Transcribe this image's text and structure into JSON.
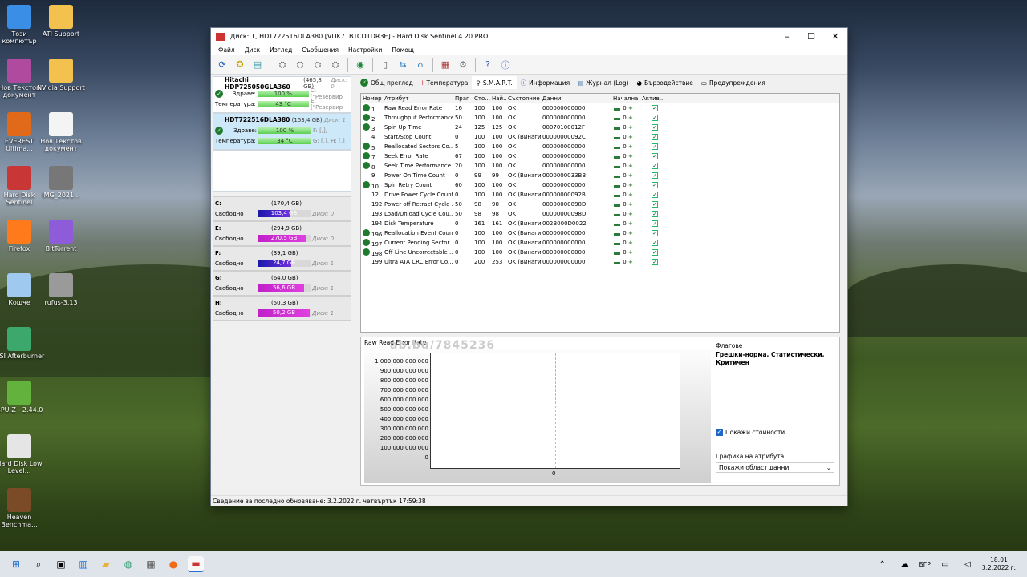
{
  "window": {
    "title": "Диск: 1, HDT722516DLA380 [VDK71BTCD1DR3E]  -  Hard Disk Sentinel 4.20 PRO"
  },
  "menu": [
    "Файл",
    "Диск",
    "Изглед",
    "Съобщения",
    "Настройки",
    "Помощ"
  ],
  "disks": [
    {
      "name": "Hitachi HDP725050GLA360",
      "size": "(465,8 GB)",
      "disk": "Диск: 0",
      "health_label": "Здраве:",
      "health": "100 %",
      "health_extra": "C: [\"Резервир",
      "temp_label": "Температура:",
      "temp": "43 °C",
      "temp_extra": "E: [\"Резервир"
    },
    {
      "name": "HDT722516DLA380",
      "size": "(153,4 GB)",
      "disk": "Диск: 1",
      "health_label": "Здраве:",
      "health": "100 %",
      "health_extra": "F: [,],",
      "temp_label": "Температура:",
      "temp": "34 °C",
      "temp_extra": "G: [,], H: [,]"
    }
  ],
  "partitions": [
    {
      "letter": "C:",
      "size": "(170,4 GB)",
      "free_label": "Свободно",
      "free": "103,4 GB",
      "disk": "Диск: 0",
      "fill": 0.61
    },
    {
      "letter": "E:",
      "size": "(294,9 GB)",
      "free_label": "Свободно",
      "free": "270,5 GB",
      "disk": "Диск: 0",
      "fill": 0.92
    },
    {
      "letter": "F:",
      "size": "(39,1 GB)",
      "free_label": "Свободно",
      "free": "24,7 GB",
      "disk": "Диск: 1",
      "fill": 0.63
    },
    {
      "letter": "G:",
      "size": "(64,0 GB)",
      "free_label": "Свободно",
      "free": "56,6 GB",
      "disk": "Диск: 1",
      "fill": 0.88
    },
    {
      "letter": "H:",
      "size": "(50,3 GB)",
      "free_label": "Свободно",
      "free": "50,2 GB",
      "disk": "Диск: 1",
      "fill": 0.99
    }
  ],
  "tabs": [
    "Общ преглед",
    "Температура",
    "S.M.A.R.T.",
    "Информация",
    "Журнал (Log)",
    "Бързодействие",
    "Предупреждения"
  ],
  "smart": {
    "headers": [
      "Номер",
      "Атрибут",
      "Праг",
      "Сто...",
      "Най...",
      "Състояние",
      "Данни",
      "Начална",
      "Актив..."
    ],
    "rows": [
      {
        "n": "1",
        "attr": "Raw Read Error Rate",
        "th": "16",
        "v": "100",
        "w": "100",
        "st": "OK",
        "data": "000000000000",
        "start": "0",
        "ok": true
      },
      {
        "n": "2",
        "attr": "Throughput Performance",
        "th": "50",
        "v": "100",
        "w": "100",
        "st": "OK",
        "data": "000000000000",
        "start": "0",
        "ok": true
      },
      {
        "n": "3",
        "attr": "Spin Up Time",
        "th": "24",
        "v": "125",
        "w": "125",
        "st": "OK",
        "data": "00070100012F",
        "start": "0",
        "ok": true
      },
      {
        "n": "4",
        "attr": "Start/Stop Count",
        "th": "0",
        "v": "100",
        "w": "100",
        "st": "OK (Винаги...",
        "data": "00000000092C",
        "start": "0",
        "ok": false
      },
      {
        "n": "5",
        "attr": "Reallocated Sectors Co...",
        "th": "5",
        "v": "100",
        "w": "100",
        "st": "OK",
        "data": "000000000000",
        "start": "0",
        "ok": true
      },
      {
        "n": "7",
        "attr": "Seek Error Rate",
        "th": "67",
        "v": "100",
        "w": "100",
        "st": "OK",
        "data": "000000000000",
        "start": "0",
        "ok": true
      },
      {
        "n": "8",
        "attr": "Seek Time Performance",
        "th": "20",
        "v": "100",
        "w": "100",
        "st": "OK",
        "data": "000000000000",
        "start": "0",
        "ok": true
      },
      {
        "n": "9",
        "attr": "Power On Time Count",
        "th": "0",
        "v": "99",
        "w": "99",
        "st": "OK (Винаги...",
        "data": "0000000033BB",
        "start": "0",
        "ok": false
      },
      {
        "n": "10",
        "attr": "Spin Retry Count",
        "th": "60",
        "v": "100",
        "w": "100",
        "st": "OK",
        "data": "000000000000",
        "start": "0",
        "ok": true
      },
      {
        "n": "12",
        "attr": "Drive Power Cycle Count",
        "th": "0",
        "v": "100",
        "w": "100",
        "st": "OK (Винаги...",
        "data": "00000000092B",
        "start": "0",
        "ok": false
      },
      {
        "n": "192",
        "attr": "Power off Retract Cycle ...",
        "th": "50",
        "v": "98",
        "w": "98",
        "st": "OK",
        "data": "00000000098D",
        "start": "0",
        "ok": false
      },
      {
        "n": "193",
        "attr": "Load/Unload Cycle Cou...",
        "th": "50",
        "v": "98",
        "w": "98",
        "st": "OK",
        "data": "00000000098D",
        "start": "0",
        "ok": false
      },
      {
        "n": "194",
        "attr": "Disk Temperature",
        "th": "0",
        "v": "161",
        "w": "161",
        "st": "OK (Винаги...",
        "data": "002B000D0022",
        "start": "0",
        "ok": false
      },
      {
        "n": "196",
        "attr": "Reallocation Event Count",
        "th": "0",
        "v": "100",
        "w": "100",
        "st": "OK (Винаги...",
        "data": "000000000000",
        "start": "0",
        "ok": true
      },
      {
        "n": "197",
        "attr": "Current Pending Sector...",
        "th": "0",
        "v": "100",
        "w": "100",
        "st": "OK (Винаги...",
        "data": "000000000000",
        "start": "0",
        "ok": true
      },
      {
        "n": "198",
        "attr": "Off-Line Uncorrectable ...",
        "th": "0",
        "v": "100",
        "w": "100",
        "st": "OK (Винаги...",
        "data": "000000000000",
        "start": "0",
        "ok": true
      },
      {
        "n": "199",
        "attr": "Ultra ATA CRC Error Co...",
        "th": "0",
        "v": "200",
        "w": "253",
        "st": "OK (Винаги...",
        "data": "000000000000",
        "start": "0",
        "ok": false
      }
    ]
  },
  "chart": {
    "title": "Raw Read Error Rate",
    "yticks": [
      "1 000 000 000 000",
      "900 000 000 000",
      "800 000 000 000",
      "700 000 000 000",
      "600 000 000 000",
      "500 000 000 000",
      "400 000 000 000",
      "300 000 000 000",
      "200 000 000 000",
      "100 000 000 000",
      "0"
    ],
    "x_label": "0"
  },
  "side": {
    "flags_label": "Флагове",
    "flags": "Грешки-норма, Статистически, Критичен",
    "show_values": "Покажи стойности",
    "attr_graph_label": "Графика на атрибута",
    "attr_graph_value": "Покажи област данни"
  },
  "status": "Сведение за последно обновяване: 3.2.2022 г. четвъртък 17:59:38",
  "watermark": "ab.bg/7845236",
  "desktop": [
    {
      "label": "Този компютър",
      "color": "#3a8ee6"
    },
    {
      "label": "ATI Support",
      "color": "#f2c14e"
    },
    {
      "label": "Нов Текстов документ",
      "color": "#b04a9e"
    },
    {
      "label": "NVidia Support",
      "color": "#f2c14e"
    },
    {
      "label": "EVEREST Ultima...",
      "color": "#e06a1a"
    },
    {
      "label": "Нов Текстов документ",
      "color": "#f4f4f4"
    },
    {
      "label": "Hard Disk Sentinel",
      "color": "#c93636"
    },
    {
      "label": "IMG_2021...",
      "color": "#777777"
    },
    {
      "label": "Firefox",
      "color": "#ff7a1a"
    },
    {
      "label": "BitTorrent",
      "color": "#8e5cd8"
    },
    {
      "label": "Кошче",
      "color": "#9fc9ef"
    },
    {
      "label": "rufus-3.13",
      "color": "#9a9a9a"
    },
    {
      "label": "MSI Afterburner",
      "color": "#3da86b"
    },
    {
      "label": "GPU-Z - 2.44.0",
      "color": "#62b23d"
    },
    {
      "label": "Hard Disk Low Level...",
      "color": "#e5e5e5"
    },
    {
      "label": "Heaven Benchma...",
      "color": "#7a4b26"
    }
  ],
  "tray": {
    "lang": "БГР",
    "time": "18:01",
    "date": "3.2.2022 г."
  }
}
